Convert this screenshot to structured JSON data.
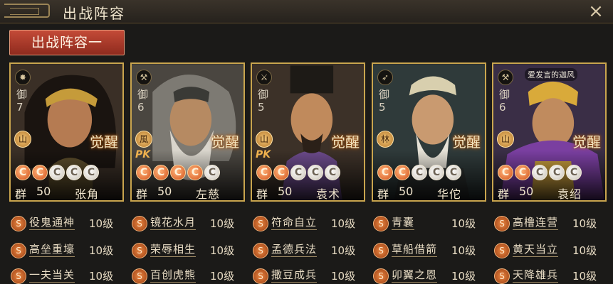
{
  "window": {
    "title": "出战阵容",
    "close_glyph": "×"
  },
  "lineup_tab": {
    "label": "出战阵容一"
  },
  "watermark": "爱发言的迦风",
  "generals": [
    {
      "def_label": "御",
      "def_value": "7",
      "terrain": "山",
      "pk": "",
      "awaken": "觉醒",
      "stars": 5,
      "faction": "群",
      "cost": "50",
      "name": "张角",
      "skills": [
        {
          "name": "役鬼通神",
          "level": "10级"
        },
        {
          "name": "高垒重壕",
          "level": "10级"
        },
        {
          "name": "一夫当关",
          "level": "10级"
        }
      ]
    },
    {
      "def_label": "御",
      "def_value": "6",
      "terrain": "風",
      "pk": "PK",
      "awaken": "觉醒",
      "stars": 5,
      "faction": "群",
      "cost": "50",
      "name": "左慈",
      "skills": [
        {
          "name": "镜花水月",
          "level": "10级"
        },
        {
          "name": "荣辱相生",
          "level": "10级"
        },
        {
          "name": "百创虎熊",
          "level": "10级"
        }
      ]
    },
    {
      "def_label": "御",
      "def_value": "5",
      "terrain": "山",
      "pk": "PK",
      "awaken": "觉醒",
      "stars": 5,
      "faction": "群",
      "cost": "50",
      "name": "袁术",
      "skills": [
        {
          "name": "符命自立",
          "level": "10级"
        },
        {
          "name": "孟德兵法",
          "level": "10级"
        },
        {
          "name": "撒豆成兵",
          "level": "10级"
        }
      ]
    },
    {
      "def_label": "御",
      "def_value": "5",
      "terrain": "林",
      "pk": "",
      "awaken": "觉醒",
      "stars": 5,
      "faction": "群",
      "cost": "50",
      "name": "华佗",
      "skills": [
        {
          "name": "青囊",
          "level": "10级"
        },
        {
          "name": "草船借箭",
          "level": "10级"
        },
        {
          "name": "卯翼之恩",
          "level": "10级"
        }
      ]
    },
    {
      "def_label": "御",
      "def_value": "6",
      "terrain": "山",
      "pk": "",
      "awaken": "觉醒",
      "stars": 5,
      "faction": "群",
      "cost": "50",
      "name": "袁绍",
      "skills": [
        {
          "name": "高橹连营",
          "level": "10级"
        },
        {
          "name": "黄天当立",
          "level": "10级"
        },
        {
          "name": "天降雄兵",
          "level": "10级"
        }
      ]
    }
  ]
}
